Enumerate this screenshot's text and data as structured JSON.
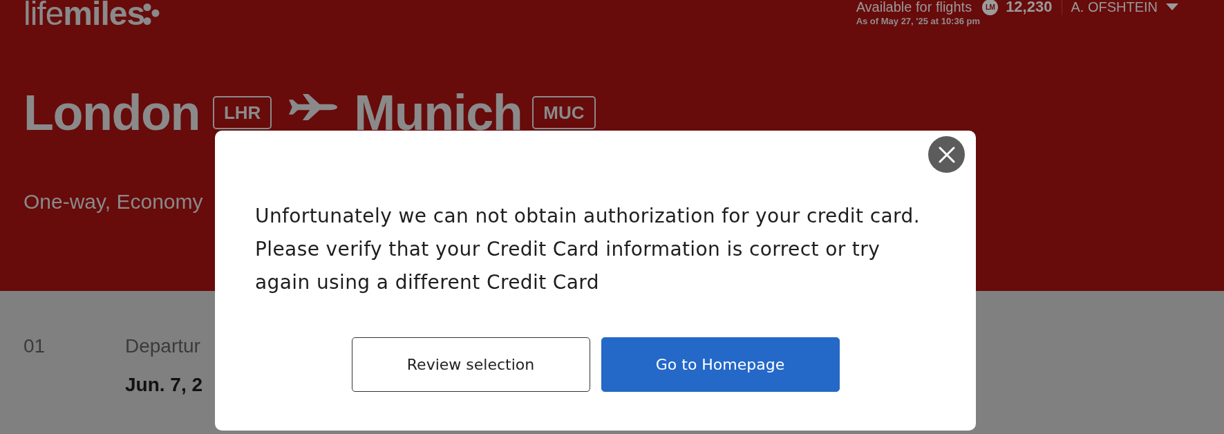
{
  "header": {
    "logo": "life**miles**",
    "account": {
      "label": "Available for flights",
      "miles_badge": "LM",
      "miles": "12,230",
      "user": "A. OFSHTEIN",
      "updated": "As of May 27, '25 at 10:36 pm"
    }
  },
  "route": {
    "origin": {
      "city": "London",
      "code": "LHR"
    },
    "destination": {
      "city": "Munich",
      "code": "MUC"
    },
    "trip": "One-way, Economy"
  },
  "segments": [
    {
      "number": "01",
      "label": "Departur",
      "date": "Jun. 7, 2"
    }
  ],
  "dialog": {
    "message": [
      "Unfortunately we can not obtain authorization for your credit card.",
      "Please verify that your Credit Card information is correct or try again using a different Credit Card"
    ],
    "buttons": [
      {
        "label": "Review selection",
        "kind": "secondary"
      },
      {
        "label": "Go to Homepage",
        "kind": "primary"
      }
    ]
  }
}
